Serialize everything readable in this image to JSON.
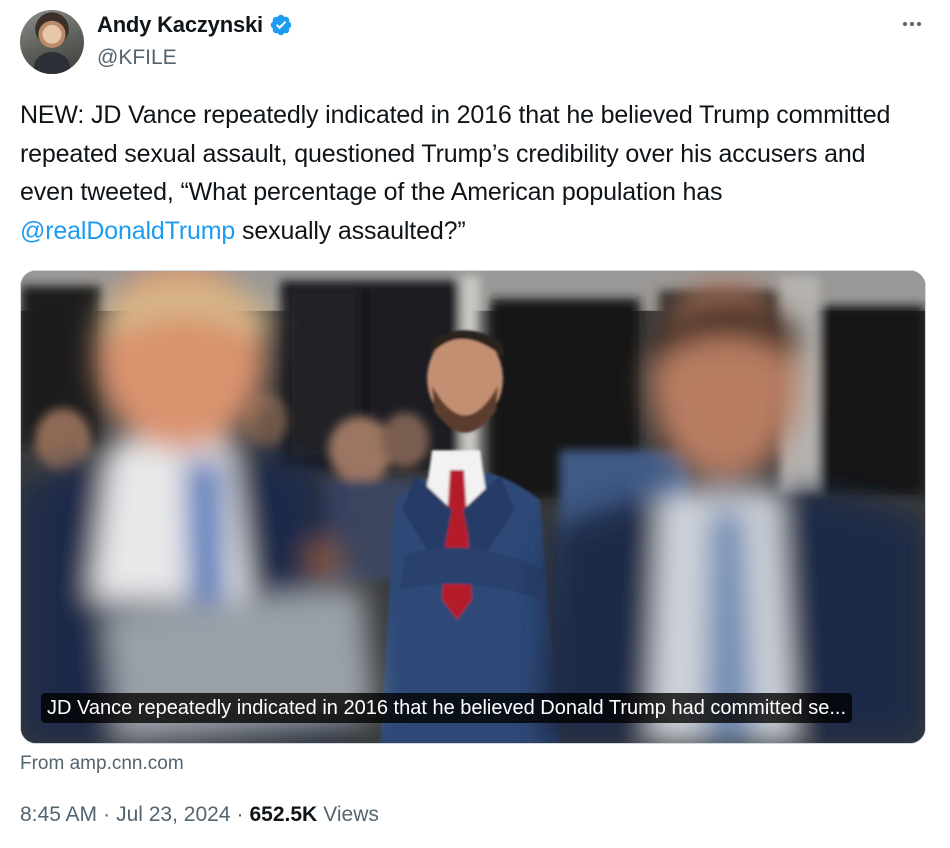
{
  "author": {
    "name": "Andy Kaczynski",
    "handle": "@KFILE",
    "verified_color": "#1d9bf0"
  },
  "tweet": {
    "text_before": "NEW: JD Vance repeatedly indicated in 2016 that he believed Trump committed repeated sexual assault, questioned Trump’s credibility over his accusers and even tweeted, “What percentage of the American population has ",
    "mention": "@realDonaldTrump",
    "text_after": " sexually assaulted?”"
  },
  "card": {
    "caption": "JD Vance repeatedly indicated in 2016 that he believed Donald Trump had committed se...",
    "source": "From amp.cnn.com"
  },
  "meta": {
    "time": "8:45 AM",
    "separator": "·",
    "date": "Jul 23, 2024",
    "views_count": "652.5K",
    "views_label": "Views"
  },
  "colors": {
    "link": "#1d9bf0",
    "secondary_text": "#536471",
    "primary_text": "#0f1419"
  },
  "icons": [
    "verified-badge-icon",
    "more-options-icon"
  ]
}
